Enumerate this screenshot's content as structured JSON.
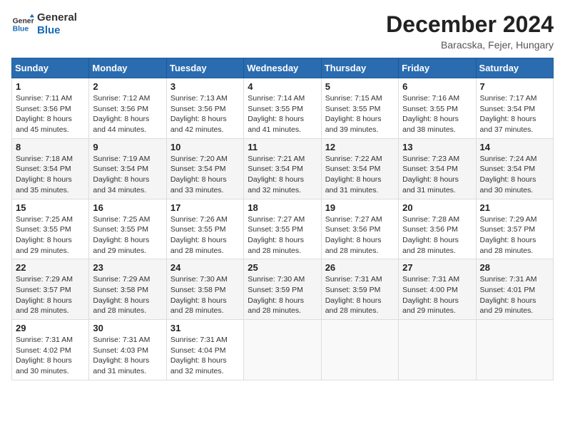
{
  "logo": {
    "line1": "General",
    "line2": "Blue"
  },
  "title": "December 2024",
  "subtitle": "Baracska, Fejer, Hungary",
  "days_of_week": [
    "Sunday",
    "Monday",
    "Tuesday",
    "Wednesday",
    "Thursday",
    "Friday",
    "Saturday"
  ],
  "weeks": [
    [
      {
        "day": 1,
        "sunrise": "7:11 AM",
        "sunset": "3:56 PM",
        "daylight": "8 hours and 45 minutes."
      },
      {
        "day": 2,
        "sunrise": "7:12 AM",
        "sunset": "3:56 PM",
        "daylight": "8 hours and 44 minutes."
      },
      {
        "day": 3,
        "sunrise": "7:13 AM",
        "sunset": "3:56 PM",
        "daylight": "8 hours and 42 minutes."
      },
      {
        "day": 4,
        "sunrise": "7:14 AM",
        "sunset": "3:55 PM",
        "daylight": "8 hours and 41 minutes."
      },
      {
        "day": 5,
        "sunrise": "7:15 AM",
        "sunset": "3:55 PM",
        "daylight": "8 hours and 39 minutes."
      },
      {
        "day": 6,
        "sunrise": "7:16 AM",
        "sunset": "3:55 PM",
        "daylight": "8 hours and 38 minutes."
      },
      {
        "day": 7,
        "sunrise": "7:17 AM",
        "sunset": "3:54 PM",
        "daylight": "8 hours and 37 minutes."
      }
    ],
    [
      {
        "day": 8,
        "sunrise": "7:18 AM",
        "sunset": "3:54 PM",
        "daylight": "8 hours and 35 minutes."
      },
      {
        "day": 9,
        "sunrise": "7:19 AM",
        "sunset": "3:54 PM",
        "daylight": "8 hours and 34 minutes."
      },
      {
        "day": 10,
        "sunrise": "7:20 AM",
        "sunset": "3:54 PM",
        "daylight": "8 hours and 33 minutes."
      },
      {
        "day": 11,
        "sunrise": "7:21 AM",
        "sunset": "3:54 PM",
        "daylight": "8 hours and 32 minutes."
      },
      {
        "day": 12,
        "sunrise": "7:22 AM",
        "sunset": "3:54 PM",
        "daylight": "8 hours and 31 minutes."
      },
      {
        "day": 13,
        "sunrise": "7:23 AM",
        "sunset": "3:54 PM",
        "daylight": "8 hours and 31 minutes."
      },
      {
        "day": 14,
        "sunrise": "7:24 AM",
        "sunset": "3:54 PM",
        "daylight": "8 hours and 30 minutes."
      }
    ],
    [
      {
        "day": 15,
        "sunrise": "7:25 AM",
        "sunset": "3:55 PM",
        "daylight": "8 hours and 29 minutes."
      },
      {
        "day": 16,
        "sunrise": "7:25 AM",
        "sunset": "3:55 PM",
        "daylight": "8 hours and 29 minutes."
      },
      {
        "day": 17,
        "sunrise": "7:26 AM",
        "sunset": "3:55 PM",
        "daylight": "8 hours and 28 minutes."
      },
      {
        "day": 18,
        "sunrise": "7:27 AM",
        "sunset": "3:55 PM",
        "daylight": "8 hours and 28 minutes."
      },
      {
        "day": 19,
        "sunrise": "7:27 AM",
        "sunset": "3:56 PM",
        "daylight": "8 hours and 28 minutes."
      },
      {
        "day": 20,
        "sunrise": "7:28 AM",
        "sunset": "3:56 PM",
        "daylight": "8 hours and 28 minutes."
      },
      {
        "day": 21,
        "sunrise": "7:29 AM",
        "sunset": "3:57 PM",
        "daylight": "8 hours and 28 minutes."
      }
    ],
    [
      {
        "day": 22,
        "sunrise": "7:29 AM",
        "sunset": "3:57 PM",
        "daylight": "8 hours and 28 minutes."
      },
      {
        "day": 23,
        "sunrise": "7:29 AM",
        "sunset": "3:58 PM",
        "daylight": "8 hours and 28 minutes."
      },
      {
        "day": 24,
        "sunrise": "7:30 AM",
        "sunset": "3:58 PM",
        "daylight": "8 hours and 28 minutes."
      },
      {
        "day": 25,
        "sunrise": "7:30 AM",
        "sunset": "3:59 PM",
        "daylight": "8 hours and 28 minutes."
      },
      {
        "day": 26,
        "sunrise": "7:31 AM",
        "sunset": "3:59 PM",
        "daylight": "8 hours and 28 minutes."
      },
      {
        "day": 27,
        "sunrise": "7:31 AM",
        "sunset": "4:00 PM",
        "daylight": "8 hours and 29 minutes."
      },
      {
        "day": 28,
        "sunrise": "7:31 AM",
        "sunset": "4:01 PM",
        "daylight": "8 hours and 29 minutes."
      }
    ],
    [
      {
        "day": 29,
        "sunrise": "7:31 AM",
        "sunset": "4:02 PM",
        "daylight": "8 hours and 30 minutes."
      },
      {
        "day": 30,
        "sunrise": "7:31 AM",
        "sunset": "4:03 PM",
        "daylight": "8 hours and 31 minutes."
      },
      {
        "day": 31,
        "sunrise": "7:31 AM",
        "sunset": "4:04 PM",
        "daylight": "8 hours and 32 minutes."
      },
      null,
      null,
      null,
      null
    ]
  ]
}
